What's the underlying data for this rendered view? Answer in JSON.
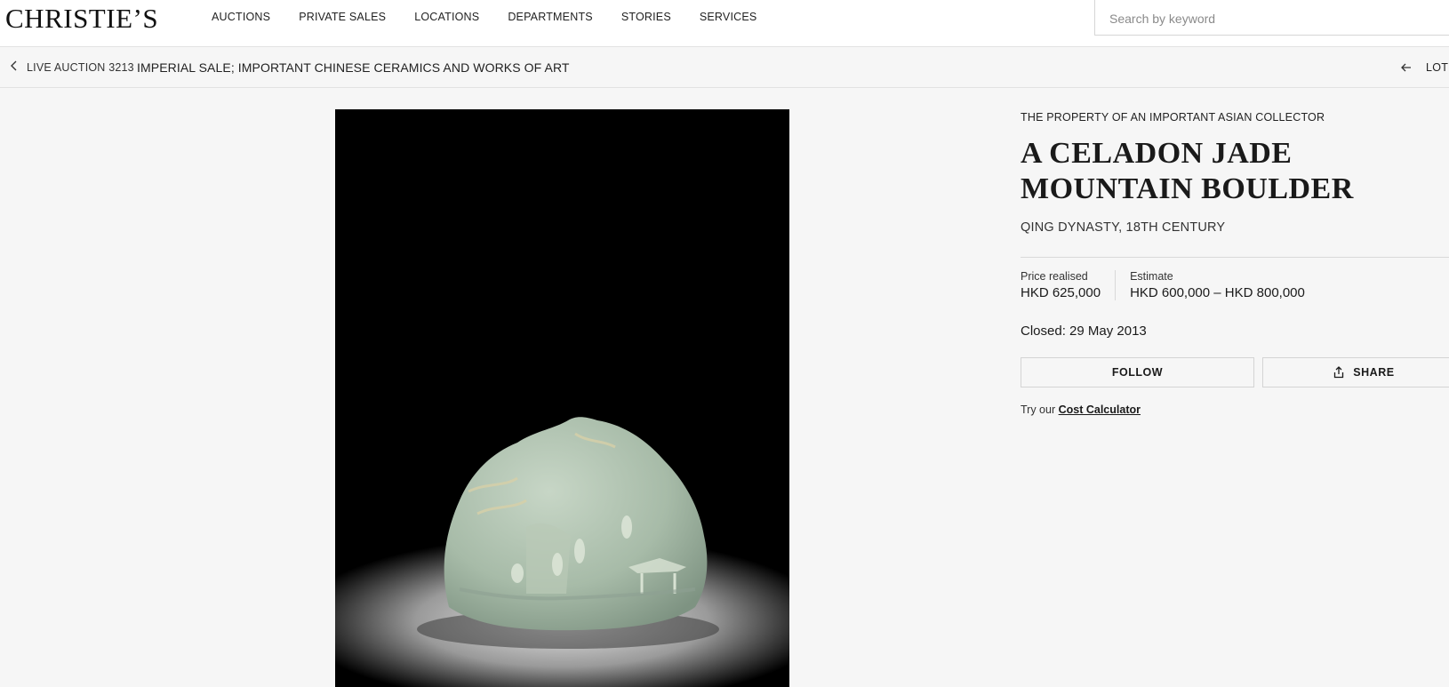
{
  "header": {
    "logo": "CHRISTIE’S",
    "nav": [
      "AUCTIONS",
      "PRIVATE SALES",
      "LOCATIONS",
      "DEPARTMENTS",
      "STORIES",
      "SERVICES"
    ],
    "search_placeholder": "Search by keyword"
  },
  "breadcrumb": {
    "prefix": "LIVE AUCTION 3213",
    "title": "IMPERIAL SALE; IMPORTANT CHINESE CERAMICS AND WORKS OF ART",
    "lot_label": "LOT"
  },
  "lot": {
    "provenance": "THE PROPERTY OF AN IMPORTANT ASIAN COLLECTOR",
    "title": "A CELADON JADE MOUNTAIN BOULDER",
    "period": "QING DYNASTY, 18TH CENTURY",
    "price_label": "Price realised",
    "price_value": "HKD 625,000",
    "estimate_label": "Estimate",
    "estimate_value": "HKD 600,000 – HKD 800,000",
    "closed_label": "Closed:",
    "closed_date": "29 May 2013",
    "follow_label": "FOLLOW",
    "share_label": "SHARE",
    "calc_prefix": "Try our",
    "calc_link": "Cost Calculator"
  },
  "icons": {
    "back": "chevron-left-icon",
    "lot_back": "arrow-left-icon",
    "share": "share-icon"
  },
  "colors": {
    "page_bg": "#f6f6f6",
    "header_bg": "#ffffff",
    "image_bg": "#000000",
    "jade": "#a9bfae"
  }
}
